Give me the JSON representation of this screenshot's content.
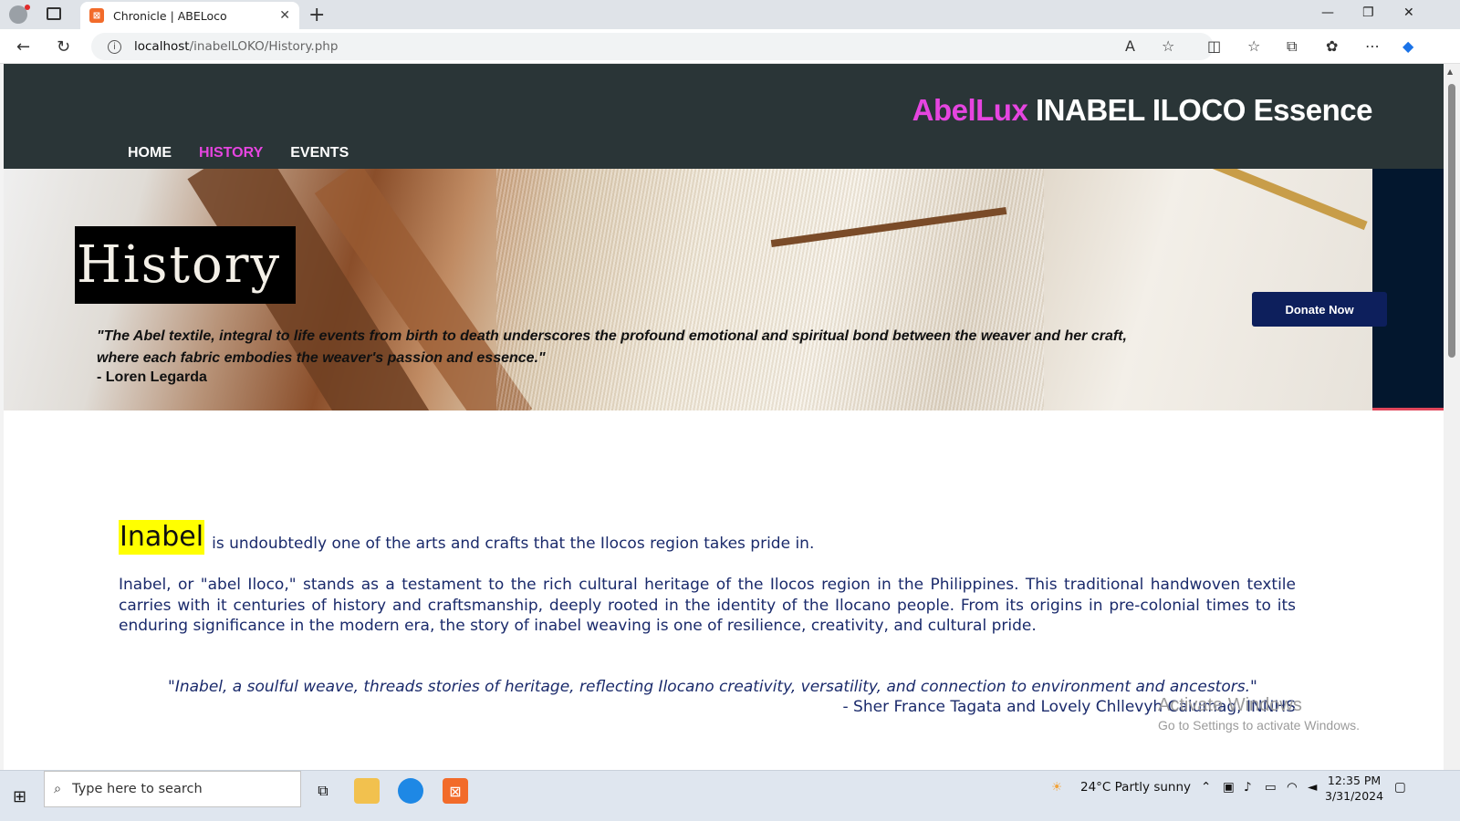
{
  "browser": {
    "tab_title": "Chronicle | ABELoco",
    "url_host": "localhost",
    "url_path": "/inabelLOKO/History.php"
  },
  "site": {
    "brand_accent": "AbelLux",
    "brand_rest": " INABEL ILOCO Essence",
    "menu": [
      {
        "label": "HOME",
        "active": false
      },
      {
        "label": "HISTORY",
        "active": true
      },
      {
        "label": "EVENTS",
        "active": false
      }
    ],
    "donate_label": "Donate Now",
    "colors": {
      "accent": "#e645e0",
      "header_bg": "#2a3537",
      "donate_bg": "#0d1f5c",
      "text": "#1a2a6b",
      "highlight": "#ffff00",
      "hero_border": "#e0465b"
    }
  },
  "hero": {
    "title": "History",
    "quote_line1": "\"The Abel textile, integral to life events from birth to death underscores the profound emotional and spiritual bond between the weaver and her craft,",
    "quote_line2": "where each fabric embodies the weaver's passion and essence.\"",
    "author": "- Loren Legarda"
  },
  "content": {
    "highlight_word": "Inabel",
    "intro_rest": "is undoubtedly one of the arts and crafts that the Ilocos region takes pride in.",
    "paragraph": "Inabel, or \"abel Iloco,\" stands as a testament to the rich cultural heritage of the Ilocos region in the Philippines. This traditional handwoven textile carries with it centuries of history and craftsmanship, deeply rooted in the identity of the Ilocano people. From its origins in pre-colonial times to its enduring significance in the modern era, the story of inabel weaving is one of resilience, creativity, and cultural pride.",
    "quote": "\"Inabel, a soulful weave, threads stories of heritage, reflecting Ilocano creativity, versatility, and connection to environment and ancestors.\"",
    "quote_author": "- Sher France Tagata and Lovely Chllevyh Calumag, INNHS"
  },
  "watermark": {
    "line1": "Activate Windows",
    "line2": "Go to Settings to activate Windows."
  },
  "taskbar": {
    "search_placeholder": "Type here to search",
    "weather": "24°C  Partly sunny",
    "time": "12:35 PM",
    "date": "3/31/2024"
  }
}
